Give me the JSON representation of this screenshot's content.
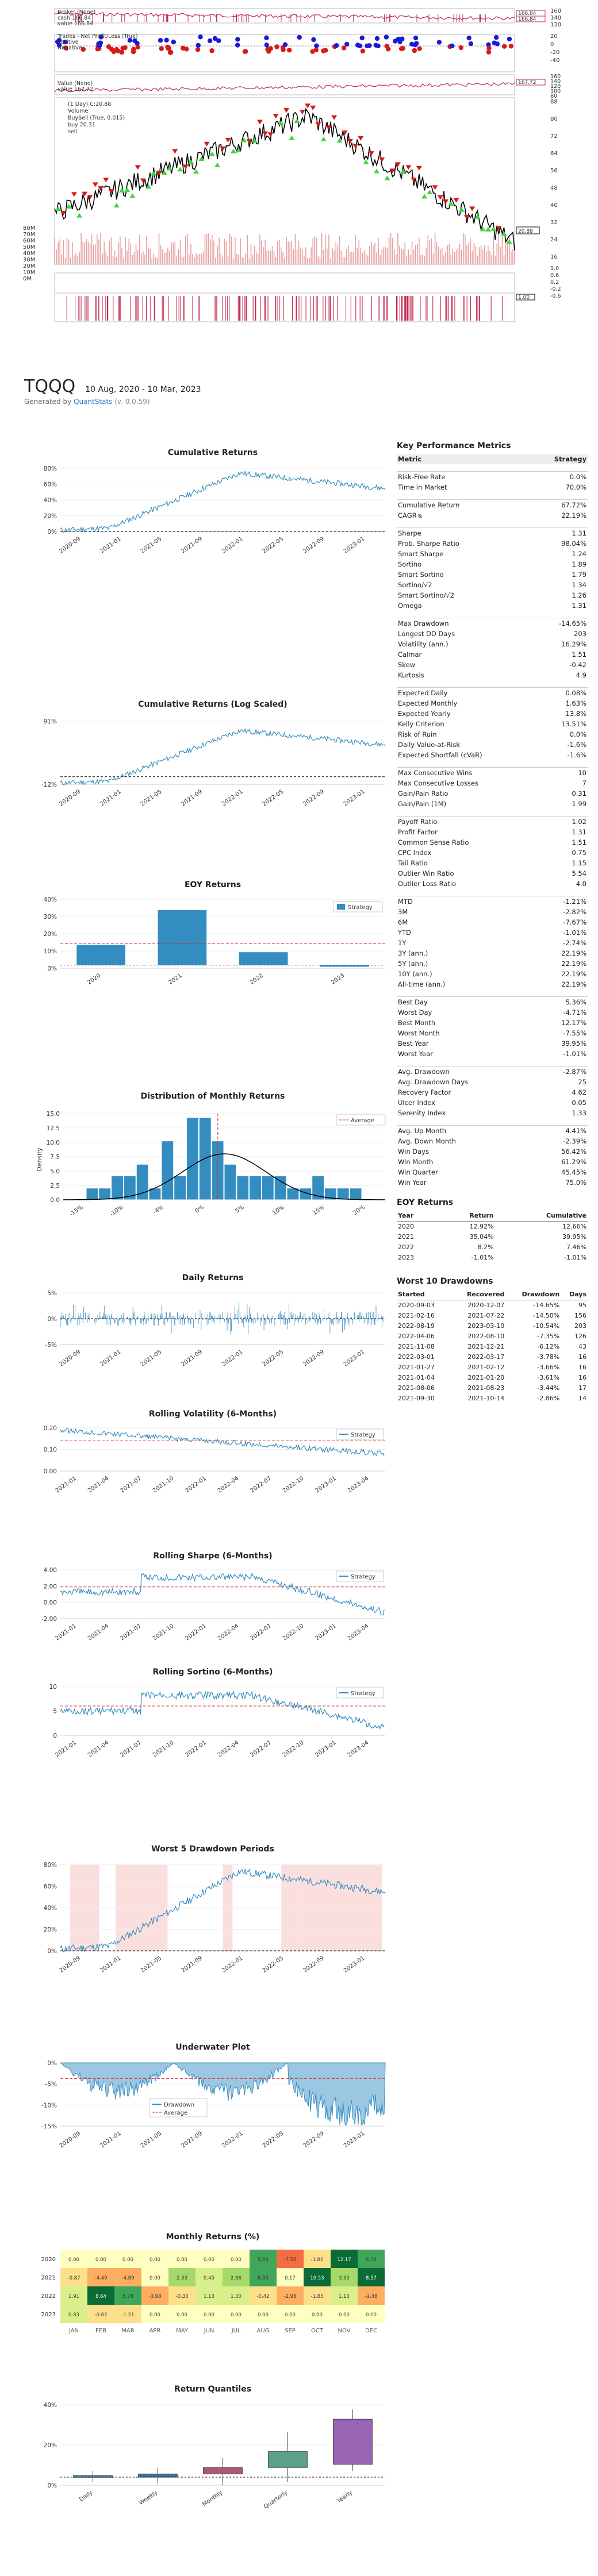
{
  "header": {
    "symbol": "TQQQ",
    "date_range": "10 Aug, 2020 - 10 Mar, 2023",
    "generated_prefix": "Generated by",
    "generator": "QuantStats",
    "version": "(v. 0.0.59)"
  },
  "backtrader": {
    "broker_legend": [
      "Broker (None)",
      "cash 166.84",
      "value 166.84"
    ],
    "broker_values": [
      "166.84",
      "166.84"
    ],
    "broker_ticks": [
      "160",
      "140",
      "120"
    ],
    "trades_legend": [
      "Trades - Net Profit/Loss (True)",
      "Positive",
      "Negative"
    ],
    "trades_ticks": [
      "20",
      "0",
      "-20",
      "-40"
    ],
    "value_legend": [
      "Value (None)",
      "value 167.72"
    ],
    "value_tag": "167.72",
    "value_ticks": [
      "160",
      "140",
      "120",
      "100",
      "80"
    ],
    "price_legend": [
      "(1 Day) C:20.88",
      "Volume",
      "BuySell (True, 0.015)",
      "buy 20.31",
      "sell"
    ],
    "price_tag": "20.88",
    "price_ticks": [
      "88",
      "80",
      "72",
      "64",
      "56",
      "48",
      "40",
      "32",
      "24",
      "16"
    ],
    "volume_ticks": [
      "80M",
      "70M",
      "60M",
      "50M",
      "40M",
      "30M",
      "20M",
      "10M",
      "0M"
    ],
    "pos_tag": "1.00",
    "pos_ticks": [
      "1.0",
      "0.6",
      "0.2",
      "-0.2",
      "-0.6"
    ]
  },
  "charts": {
    "cumulative": {
      "title": "Cumulative Returns",
      "yticks": [
        "80%",
        "60%",
        "40%",
        "20%",
        "0%"
      ],
      "xticks": [
        "2020-09",
        "2021-01",
        "2021-05",
        "2021-09",
        "2022-01",
        "2022-05",
        "2022-09",
        "2023-01"
      ]
    },
    "cumlog": {
      "title": "Cumulative Returns (Log Scaled)",
      "yticks": [
        "91%",
        "-12%"
      ],
      "xticks": [
        "2020-09",
        "2021-01",
        "2021-05",
        "2021-09",
        "2022-01",
        "2022-05",
        "2022-09",
        "2023-01"
      ]
    },
    "eoy": {
      "title": "EOY Returns",
      "legend": "Strategy",
      "yticks": [
        "40%",
        "30%",
        "20%",
        "10%",
        "0%"
      ],
      "xticks": [
        "2020",
        "2021",
        "2022",
        "2023"
      ]
    },
    "dist": {
      "title": "Distribution of Monthly Returns",
      "legend": "Average",
      "ylabel": "Density",
      "yticks": [
        "15.0",
        "12.5",
        "10.0",
        "7.5",
        "5.0",
        "2.5",
        "0.0"
      ],
      "xticks": [
        "-15%",
        "-10%",
        "-4%",
        "0%",
        "5%",
        "10%",
        "15%",
        "20%"
      ]
    },
    "daily": {
      "title": "Daily Returns",
      "yticks": [
        "5%",
        "0%",
        "-5%"
      ],
      "xticks": [
        "2020-09",
        "2021-01",
        "2021-05",
        "2021-09",
        "2022-01",
        "2022-05",
        "2022-09",
        "2023-01"
      ]
    },
    "vol": {
      "title": "Rolling Volatility (6-Months)",
      "legend": "Strategy",
      "yticks": [
        "0.20",
        "0.10",
        "0.00"
      ],
      "xticks": [
        "2021-01",
        "2021-04",
        "2021-07",
        "2021-10",
        "2022-01",
        "2022-04",
        "2022-07",
        "2022-10",
        "2023-01",
        "2023-04"
      ]
    },
    "sharpe": {
      "title": "Rolling Sharpe (6-Months)",
      "legend": "Strategy",
      "yticks": [
        "4.00",
        "2.00",
        "0.00",
        "-2.00"
      ],
      "xticks": [
        "2021-01",
        "2021-04",
        "2021-07",
        "2021-10",
        "2022-01",
        "2022-04",
        "2022-07",
        "2022-10",
        "2023-01",
        "2023-04"
      ]
    },
    "sortino": {
      "title": "Rolling Sortino (6-Months)",
      "legend": "Strategy",
      "yticks": [
        "10",
        "5",
        "0"
      ],
      "xticks": [
        "2021-01",
        "2021-04",
        "2021-07",
        "2021-10",
        "2022-01",
        "2022-04",
        "2022-07",
        "2022-10",
        "2023-01",
        "2023-04"
      ]
    },
    "worst5": {
      "title": "Worst 5 Drawdown Periods",
      "yticks": [
        "80%",
        "60%",
        "40%",
        "20%",
        "0%"
      ],
      "xticks": [
        "2020-09",
        "2021-01",
        "2021-05",
        "2021-09",
        "2022-01",
        "2022-05",
        "2022-09",
        "2023-01"
      ]
    },
    "underwater": {
      "title": "Underwater Plot",
      "legend": [
        "Drawdown",
        "Average"
      ],
      "yticks": [
        "0%",
        "-5%",
        "-10%",
        "-15%"
      ],
      "xticks": [
        "2020-09",
        "2021-01",
        "2021-05",
        "2021-09",
        "2022-01",
        "2022-05",
        "2022-09",
        "2023-01"
      ]
    },
    "heatmap": {
      "title": "Monthly Returns (%)",
      "years": [
        "2020",
        "2021",
        "2022",
        "2023"
      ],
      "months": [
        "JAN",
        "FEB",
        "MAR",
        "APR",
        "MAY",
        "JUN",
        "JUL",
        "AUG",
        "SEP",
        "OCT",
        "NOV",
        "DEC"
      ]
    },
    "quantiles": {
      "title": "Return Quantiles",
      "yticks": [
        "40%",
        "20%",
        "0%"
      ],
      "xticks": [
        "Daily",
        "Weekly",
        "Monthly",
        "Quarterly",
        "Yearly"
      ]
    }
  },
  "chart_data": [
    {
      "type": "bar",
      "title": "EOY Returns",
      "categories": [
        "2020",
        "2021",
        "2022",
        "2023"
      ],
      "series": [
        {
          "name": "Strategy",
          "values": [
            12.92,
            35.04,
            8.2,
            -1.01
          ]
        }
      ],
      "ylim": [
        -2,
        42
      ]
    },
    {
      "type": "bar",
      "title": "Distribution of Monthly Returns",
      "categories": [
        "-12%",
        "-9%",
        "-8%",
        "-7%",
        "-6%",
        "-5%",
        "-4%",
        "-3%",
        "-2%",
        "-1%",
        "0%",
        "1%",
        "2%",
        "3%",
        "4%",
        "5%",
        "6%",
        "7%",
        "8%",
        "9%",
        "10%",
        "11%"
      ],
      "values": [
        2.3,
        2.3,
        4.7,
        4.7,
        7.0,
        2.3,
        11.6,
        4.7,
        16.2,
        16.2,
        11.6,
        7.0,
        4.7,
        4.7,
        4.7,
        4.7,
        2.3,
        2.3,
        4.7,
        2.3,
        2.3,
        2.3
      ],
      "ylim": [
        0,
        17
      ]
    },
    {
      "type": "heatmap",
      "title": "Monthly Returns (%)",
      "rows": [
        "2020",
        "2021",
        "2022",
        "2023"
      ],
      "cols": [
        "JAN",
        "FEB",
        "MAR",
        "APR",
        "MAY",
        "JUN",
        "JUL",
        "AUG",
        "SEP",
        "OCT",
        "NOV",
        "DEC"
      ],
      "values": [
        [
          0.0,
          0.0,
          0.0,
          0.0,
          0.0,
          0.0,
          0.0,
          5.64,
          -7.55,
          -1.8,
          12.17,
          6.74
        ],
        [
          -0.87,
          -4.49,
          -4.89,
          0.0,
          2.33,
          0.45,
          2.66,
          6.0,
          0.17,
          10.53,
          3.63,
          8.57
        ],
        [
          1.91,
          8.64,
          5.78,
          -3.98,
          -0.33,
          1.13,
          1.3,
          -0.42,
          -2.98,
          -1.85,
          1.13,
          -2.48
        ],
        [
          0.83,
          -0.62,
          -1.21,
          0.0,
          0.0,
          0.0,
          0.0,
          0.0,
          0.0,
          0.0,
          0.0,
          0.0
        ]
      ],
      "labels": [
        [
          "0.00",
          "0.00",
          "0.00",
          "0.00",
          "0.00",
          "0.00",
          "0.00",
          "5.64",
          "-7.55",
          "-1.80",
          "12.17",
          "6.74"
        ],
        [
          "-0.87",
          "-4.49",
          "-4.89",
          "0.00",
          "2.33",
          "0.45",
          "2.66",
          "6.00",
          "0.17",
          "10.53",
          "3.63",
          "8.57"
        ],
        [
          "1.91",
          "8.64",
          "5.78",
          "-3.98",
          "-0.33",
          "1.13",
          "1.30",
          "-0.42",
          "-2.98",
          "-1.85",
          "1.13",
          "-2.48"
        ],
        [
          "0.83",
          "-0.62",
          "-1.21",
          "0.00",
          "0.00",
          "0.00",
          "0.00",
          "0.00",
          "0.00",
          "0.00",
          "0.00",
          "0.00"
        ]
      ]
    },
    {
      "type": "bar",
      "title": "Return Quantiles",
      "categories": [
        "Daily",
        "Weekly",
        "Monthly",
        "Quarterly",
        "Yearly"
      ],
      "boxes": [
        [
          -1,
          0,
          1,
          2
        ],
        [
          -2,
          0,
          2,
          4
        ],
        [
          -3,
          2,
          6,
          10
        ],
        [
          -1,
          6,
          16,
          26
        ],
        [
          6,
          8,
          36,
          40
        ]
      ],
      "ylim": [
        -5,
        45
      ]
    }
  ],
  "metrics": {
    "title": "Key Performance Metrics",
    "head": [
      "Metric",
      "Strategy"
    ],
    "groups": [
      [
        [
          "Risk-Free Rate",
          "0.0%"
        ],
        [
          "Time in Market",
          "70.0%"
        ]
      ],
      [
        [
          "Cumulative Return",
          "67.72%"
        ],
        [
          "CAGR﹪",
          "22.19%"
        ]
      ],
      [
        [
          "Sharpe",
          "1.31"
        ],
        [
          "Prob. Sharpe Ratio",
          "98.04%"
        ],
        [
          "Smart Sharpe",
          "1.24"
        ],
        [
          "Sortino",
          "1.89"
        ],
        [
          "Smart Sortino",
          "1.79"
        ],
        [
          "Sortino/√2",
          "1.34"
        ],
        [
          "Smart Sortino/√2",
          "1.26"
        ],
        [
          "Omega",
          "1.31"
        ]
      ],
      [
        [
          "Max Drawdown",
          "-14.65%"
        ],
        [
          "Longest DD Days",
          "203"
        ],
        [
          "Volatility (ann.)",
          "16.29%"
        ],
        [
          "Calmar",
          "1.51"
        ],
        [
          "Skew",
          "-0.42"
        ],
        [
          "Kurtosis",
          "4.9"
        ]
      ],
      [
        [
          "Expected Daily",
          "0.08%"
        ],
        [
          "Expected Monthly",
          "1.63%"
        ],
        [
          "Expected Yearly",
          "13.8%"
        ],
        [
          "Kelly Criterion",
          "13.51%"
        ],
        [
          "Risk of Ruin",
          "0.0%"
        ],
        [
          "Daily Value-at-Risk",
          "-1.6%"
        ],
        [
          "Expected Shortfall (cVaR)",
          "-1.6%"
        ]
      ],
      [
        [
          "Max Consecutive Wins",
          "10"
        ],
        [
          "Max Consecutive Losses",
          "7"
        ],
        [
          "Gain/Pain Ratio",
          "0.31"
        ],
        [
          "Gain/Pain (1M)",
          "1.99"
        ]
      ],
      [
        [
          "Payoff Ratio",
          "1.02"
        ],
        [
          "Profit Factor",
          "1.31"
        ],
        [
          "Common Sense Ratio",
          "1.51"
        ],
        [
          "CPC Index",
          "0.75"
        ],
        [
          "Tail Ratio",
          "1.15"
        ],
        [
          "Outlier Win Ratio",
          "5.54"
        ],
        [
          "Outlier Loss Ratio",
          "4.0"
        ]
      ],
      [
        [
          "MTD",
          "-1.21%"
        ],
        [
          "3M",
          "-2.82%"
        ],
        [
          "6M",
          "-7.67%"
        ],
        [
          "YTD",
          "-1.01%"
        ],
        [
          "1Y",
          "-2.74%"
        ],
        [
          "3Y (ann.)",
          "22.19%"
        ],
        [
          "5Y (ann.)",
          "22.19%"
        ],
        [
          "10Y (ann.)",
          "22.19%"
        ],
        [
          "All-time (ann.)",
          "22.19%"
        ]
      ],
      [
        [
          "Best Day",
          "5.36%"
        ],
        [
          "Worst Day",
          "-4.71%"
        ],
        [
          "Best Month",
          "12.17%"
        ],
        [
          "Worst Month",
          "-7.55%"
        ],
        [
          "Best Year",
          "39.95%"
        ],
        [
          "Worst Year",
          "-1.01%"
        ]
      ],
      [
        [
          "Avg. Drawdown",
          "-2.87%"
        ],
        [
          "Avg. Drawdown Days",
          "25"
        ],
        [
          "Recovery Factor",
          "4.62"
        ],
        [
          "Ulcer Index",
          "0.05"
        ],
        [
          "Serenity Index",
          "1.33"
        ]
      ],
      [
        [
          "Avg. Up Month",
          "4.41%"
        ],
        [
          "Avg. Down Month",
          "-2.39%"
        ],
        [
          "Win Days",
          "56.42%"
        ],
        [
          "Win Month",
          "61.29%"
        ],
        [
          "Win Quarter",
          "45.45%"
        ],
        [
          "Win Year",
          "75.0%"
        ]
      ]
    ]
  },
  "eoy_table": {
    "title": "EOY Returns",
    "head": [
      "Year",
      "Return",
      "Cumulative"
    ],
    "rows": [
      [
        "2020",
        "12.92%",
        "12.66%"
      ],
      [
        "2021",
        "35.04%",
        "39.95%"
      ],
      [
        "2022",
        "8.2%",
        "7.46%"
      ],
      [
        "2023",
        "-1.01%",
        "-1.01%"
      ]
    ]
  },
  "dd_table": {
    "title": "Worst 10 Drawdowns",
    "head": [
      "Started",
      "Recovered",
      "Drawdown",
      "Days"
    ],
    "rows": [
      [
        "2020-09-03",
        "2020-12-07",
        "-14.65%",
        "95"
      ],
      [
        "2021-02-16",
        "2021-07-22",
        "-14.50%",
        "156"
      ],
      [
        "2022-08-19",
        "2023-03-10",
        "-10.54%",
        "203"
      ],
      [
        "2022-04-06",
        "2022-08-10",
        "-7.35%",
        "126"
      ],
      [
        "2021-11-08",
        "2021-12-21",
        "-6.12%",
        "43"
      ],
      [
        "2022-03-01",
        "2022-03-17",
        "-3.78%",
        "16"
      ],
      [
        "2021-01-27",
        "2021-02-12",
        "-3.66%",
        "16"
      ],
      [
        "2021-01-04",
        "2021-01-20",
        "-3.61%",
        "16"
      ],
      [
        "2021-08-06",
        "2021-08-23",
        "-3.44%",
        "17"
      ],
      [
        "2021-09-30",
        "2021-10-14",
        "-2.86%",
        "14"
      ]
    ]
  }
}
